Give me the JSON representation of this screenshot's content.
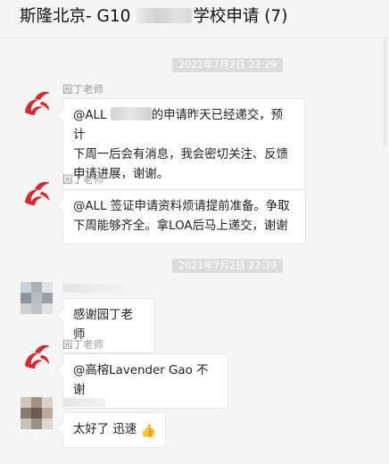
{
  "window": {
    "title_start": "斯隆北京- G10 ",
    "title_end": "学校申请 (7)"
  },
  "timestamps": [
    "2021年7月2日 22:29",
    "2021年7月2日 22:39"
  ],
  "messages": [
    {
      "sender": "园丁老师",
      "text_part1": "@ALL ",
      "text_part2": "的申请昨天已经递交，预计",
      "line2": "下周一后会有消息，我会密切关注、反馈",
      "line3": "申请进展，谢谢。"
    },
    {
      "sender": "园丁老师",
      "line1": "@ALL 签证申请资料烦请提前准备。争取",
      "line2": "下周能够齐全。拿LOA后马上递交，谢谢"
    },
    {
      "text": "感谢园丁老师"
    },
    {
      "sender": "园丁老师",
      "text": "@高榕Lavender Gao 不谢"
    },
    {
      "text": "太好了 迅速",
      "emoji": "👍"
    }
  ],
  "colors": {
    "logo_red": "#d8282d",
    "background": "#f5f5f5",
    "bubble": "#ffffff"
  }
}
